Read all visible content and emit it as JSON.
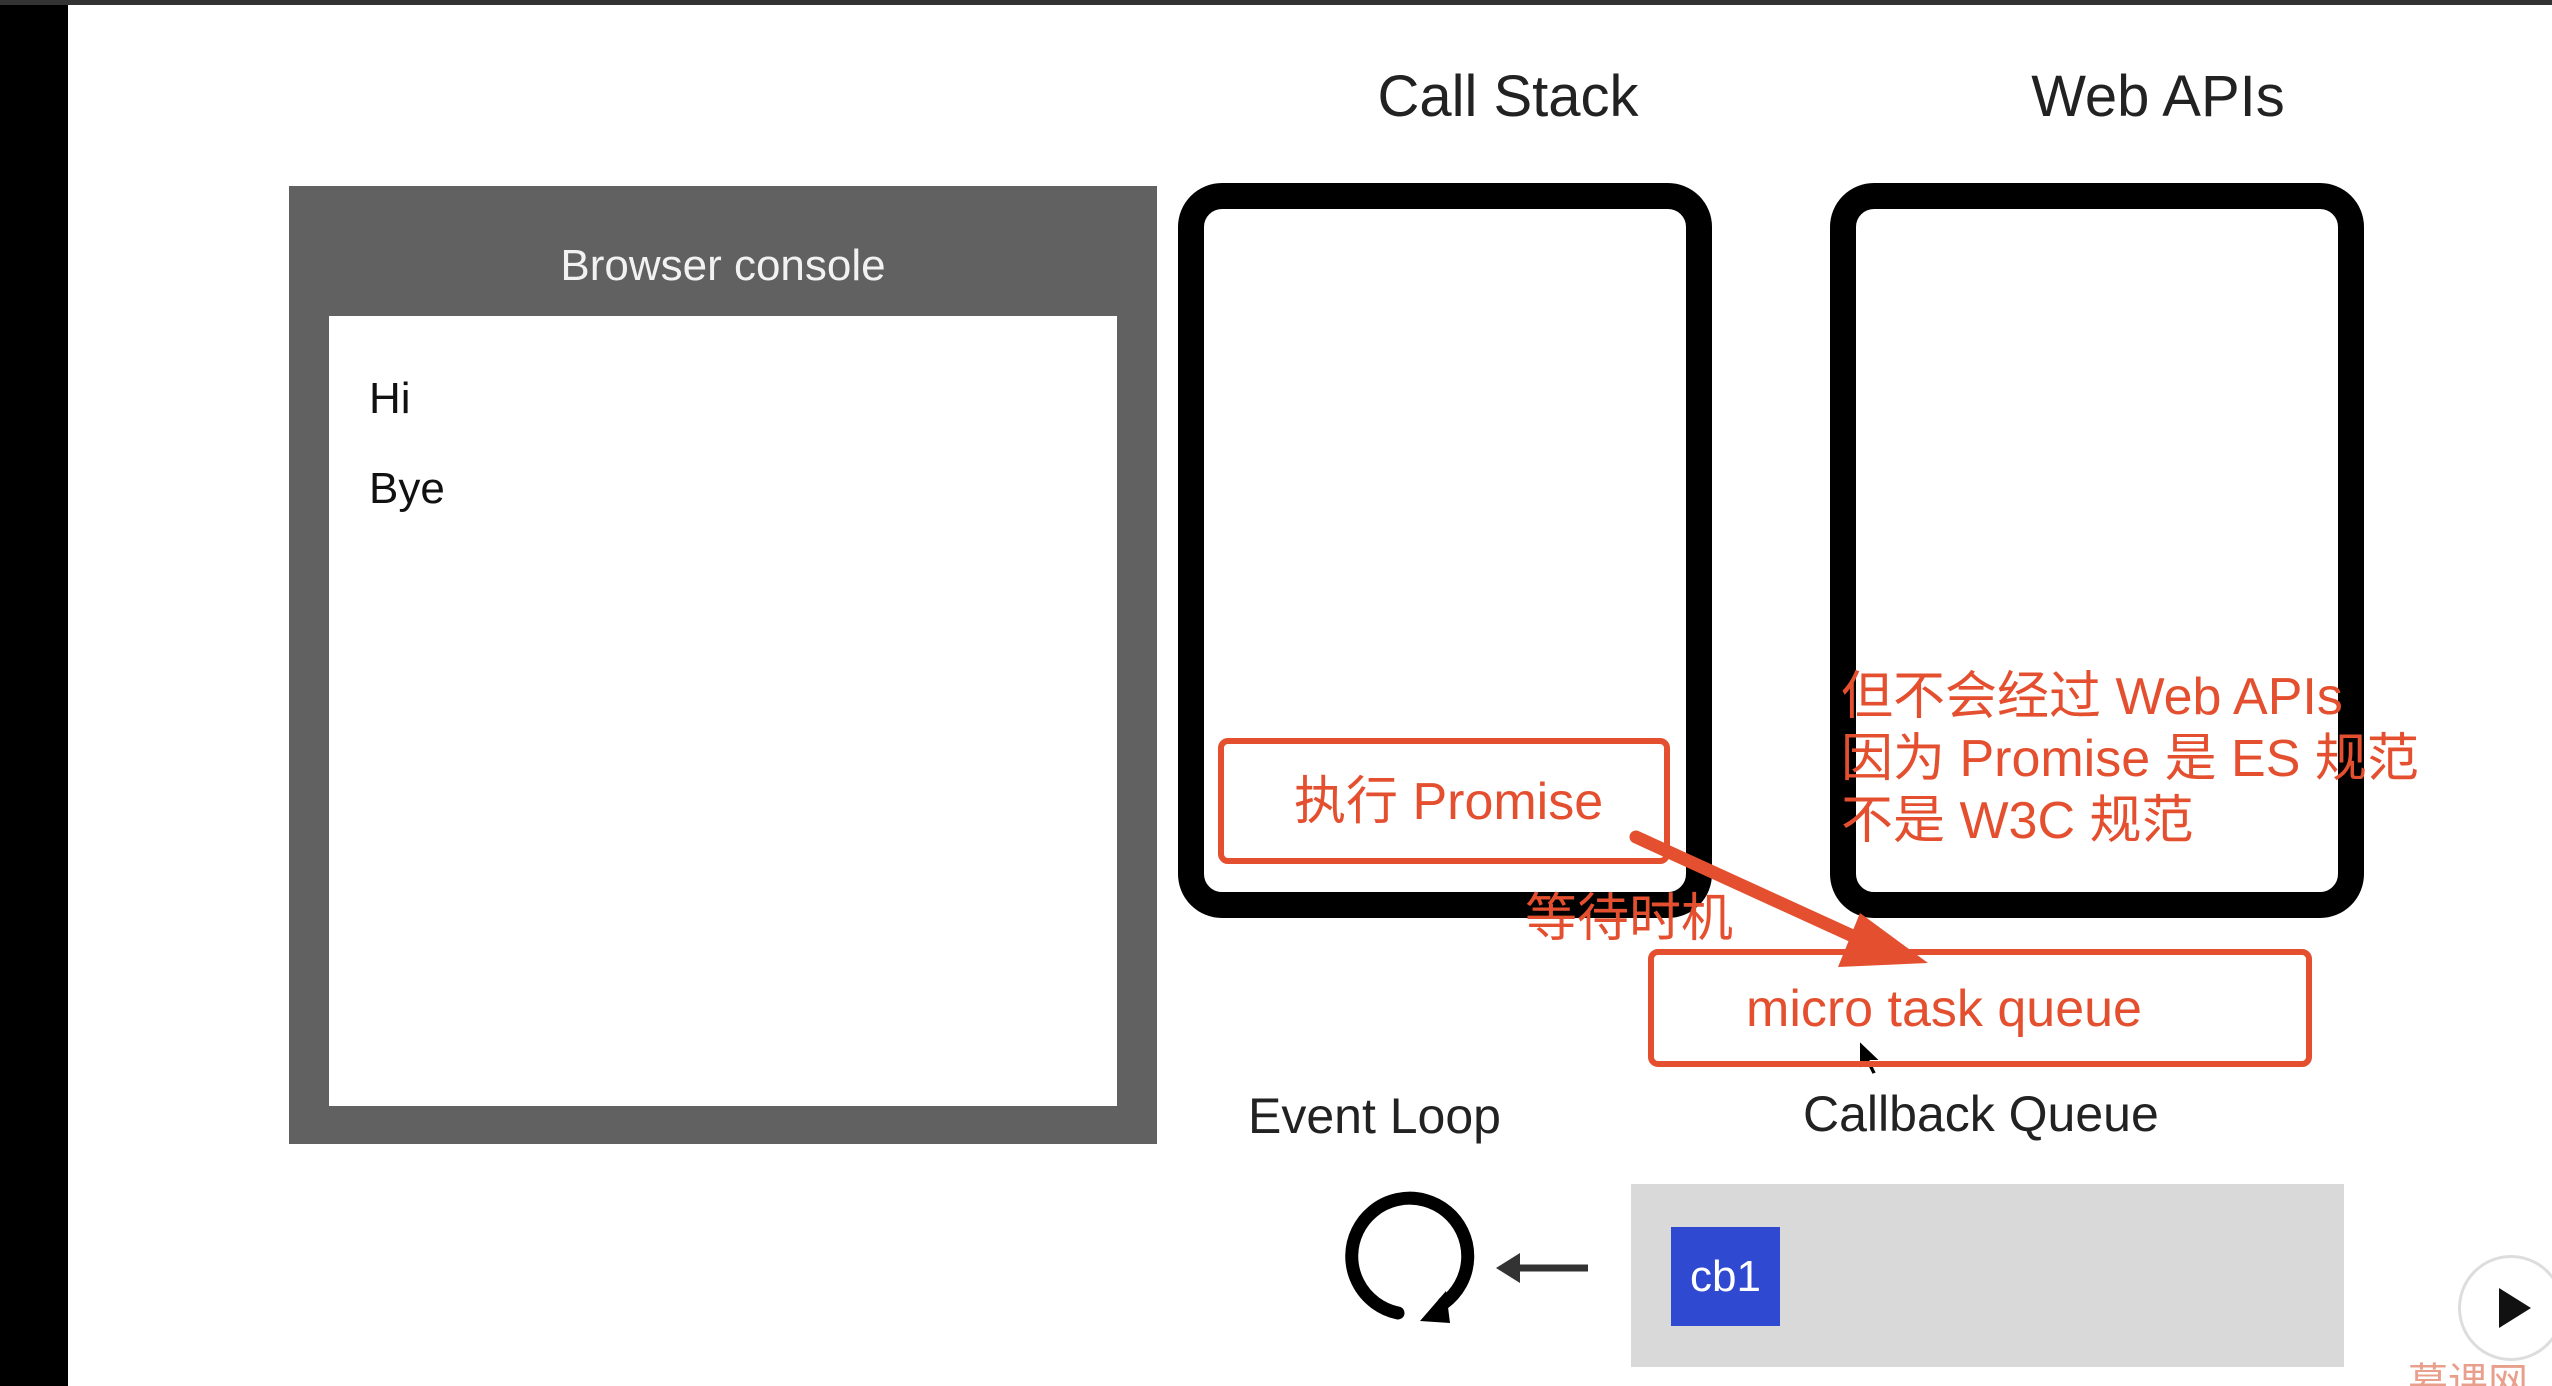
{
  "console": {
    "title": "Browser console",
    "lines": [
      "Hi",
      "Bye"
    ]
  },
  "headings": {
    "call_stack": "Call Stack",
    "web_apis": "Web APIs"
  },
  "labels": {
    "event_loop": "Event Loop",
    "callback_queue": "Callback Queue"
  },
  "annotations": {
    "execute_promise": "执行 Promise",
    "wait_timing": "等待时机",
    "micro_task_queue": "micro task queue",
    "note_lines": [
      "但不会经过 Web APIs",
      "因为 Promise 是 ES 规范",
      "不是 W3C 规范"
    ]
  },
  "queue": {
    "item": "cb1"
  },
  "watermark": "慕课网",
  "colors": {
    "accent_red": "#e4502f",
    "cb1_blue": "#2f49d1",
    "console_gray": "#616161"
  }
}
